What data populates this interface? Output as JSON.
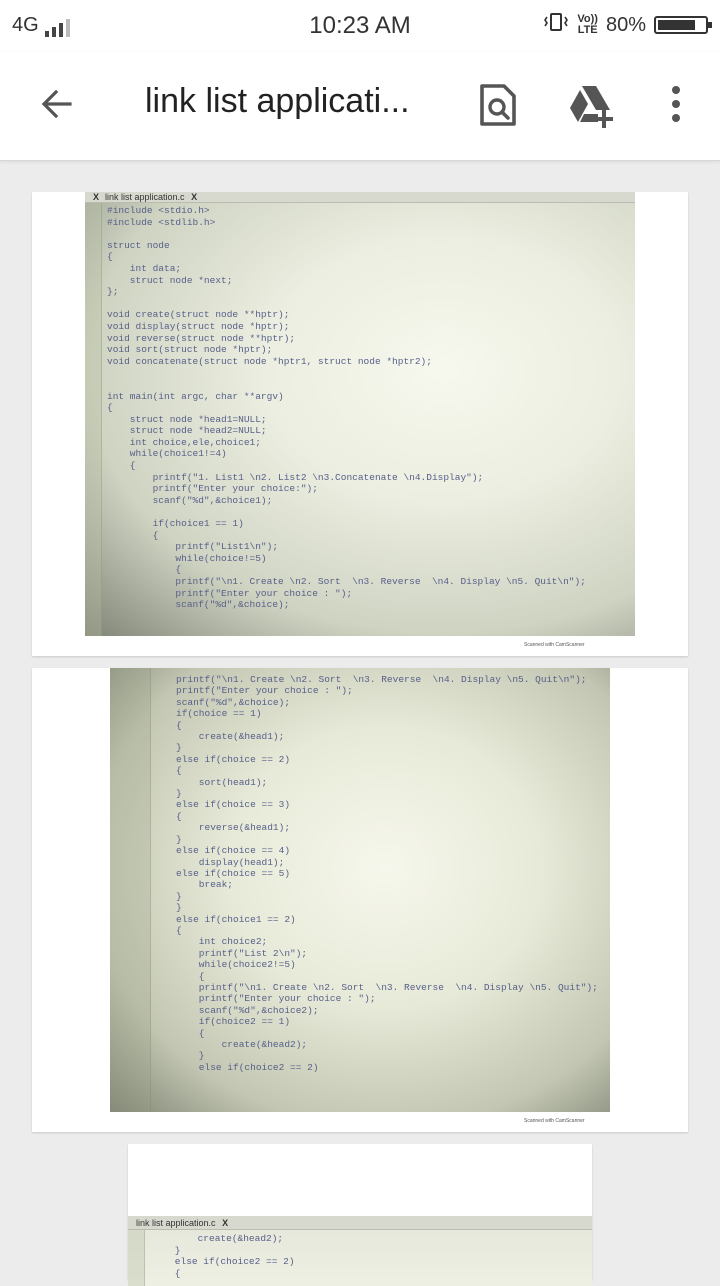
{
  "status_bar": {
    "network": "4G",
    "time": "10:23 AM",
    "volte": "Vo))",
    "lte": "LTE",
    "battery": "80%",
    "battery_level": 0.8
  },
  "app_bar": {
    "title": "link list applicati...",
    "back_icon": "arrow-back-icon",
    "lens_icon": "google-lens-icon",
    "drive_icon": "add-to-drive-icon",
    "more_icon": "more-vert-icon"
  },
  "pages": [
    {
      "tab_label": "link list application.c",
      "tab_close": "X",
      "footer": "Scanned with CamScanner",
      "code": [
        "#include <stdio.h>",
        "#include <stdlib.h>",
        "",
        "struct node",
        "{",
        "    int data;",
        "    struct node *next;",
        "};",
        "",
        "void create(struct node **hptr);",
        "void display(struct node *hptr);",
        "void reverse(struct node **hptr);",
        "void sort(struct node *hptr);",
        "void concatenate(struct node *hptr1, struct node *hptr2);",
        "",
        "",
        "int main(int argc, char **argv)",
        "{",
        "    struct node *head1=NULL;",
        "    struct node *head2=NULL;",
        "    int choice,ele,choice1;",
        "    while(choice1!=4)",
        "    {",
        "        printf(\"1. List1 \\n2. List2 \\n3.Concatenate \\n4.Display\");",
        "        printf(\"Enter your choice:\");",
        "        scanf(\"%d\",&choice1);",
        "",
        "        if(choice1 == 1)",
        "        {",
        "            printf(\"List1\\n\");",
        "            while(choice!=5)",
        "            {",
        "            printf(\"\\n1. Create \\n2. Sort  \\n3. Reverse  \\n4. Display \\n5. Quit\\n\");",
        "            printf(\"Enter your choice : \");",
        "            scanf(\"%d\",&choice);"
      ]
    },
    {
      "footer": "Scanned with CamScanner",
      "code": [
        "printf(\"\\n1. Create \\n2. Sort  \\n3. Reverse  \\n4. Display \\n5. Quit\\n\");",
        "printf(\"Enter your choice : \");",
        "scanf(\"%d\",&choice);",
        "if(choice == 1)",
        "{",
        "    create(&head1);",
        "}",
        "else if(choice == 2)",
        "{",
        "    sort(head1);",
        "}",
        "else if(choice == 3)",
        "{",
        "    reverse(&head1);",
        "}",
        "else if(choice == 4)",
        "    display(head1);",
        "else if(choice == 5)",
        "    break;",
        "}",
        "}",
        "else if(choice1 == 2)",
        "{",
        "    int choice2;",
        "    printf(\"List 2\\n\");",
        "    while(choice2!=5)",
        "    {",
        "    printf(\"\\n1. Create \\n2. Sort  \\n3. Reverse  \\n4. Display \\n5. Quit\");",
        "    printf(\"Enter your choice : \");",
        "    scanf(\"%d\",&choice2);",
        "    if(choice2 == 1)",
        "    {",
        "        create(&head2);",
        "    }",
        "    else if(choice2 == 2)"
      ]
    },
    {
      "tab_label": "link list application.c",
      "tab_close": "X",
      "code": [
        "        create(&head2);",
        "    }",
        "    else if(choice2 == 2)",
        "    {"
      ]
    }
  ]
}
